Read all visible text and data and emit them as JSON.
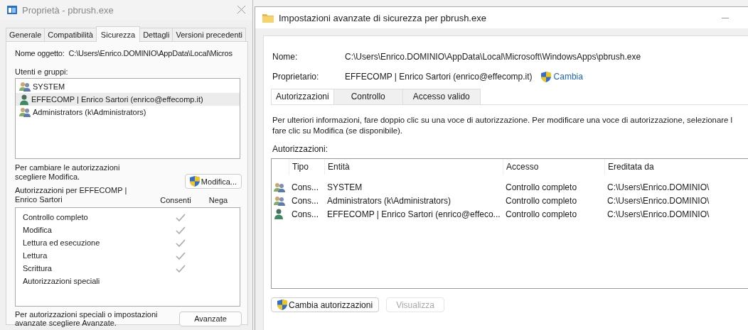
{
  "properties_window": {
    "title": "Proprietà - pbrush.exe",
    "tabs": [
      {
        "label": "Generale",
        "selected": false
      },
      {
        "label": "Compatibilità",
        "selected": false
      },
      {
        "label": "Sicurezza",
        "selected": true
      },
      {
        "label": "Dettagli",
        "selected": false
      },
      {
        "label": "Versioni precedenti",
        "selected": false
      }
    ],
    "object_name_label": "Nome oggetto:",
    "object_name": "C:\\Users\\Enrico.DOMINIO\\AppData\\Local\\Micros",
    "groups_label": "Utenti e gruppi:",
    "groups": [
      {
        "name": "SYSTEM",
        "kind": "group",
        "selected": false
      },
      {
        "name": "EFFECOMP | Enrico Sartori (enrico@effecomp.it)",
        "kind": "user",
        "selected": true
      },
      {
        "name": "Administrators (k\\Administrators)",
        "kind": "group",
        "selected": false
      }
    ],
    "change_hint": "Per cambiare le autorizzazioni scegliere Modifica.",
    "edit_button": "Modifica...",
    "permissions_label": "Autorizzazioni per EFFECOMP | Enrico Sartori",
    "allow_header": "Consenti",
    "deny_header": "Nega",
    "permissions": [
      {
        "name": "Controllo completo",
        "allow": true,
        "deny": false
      },
      {
        "name": "Modifica",
        "allow": true,
        "deny": false
      },
      {
        "name": "Lettura ed esecuzione",
        "allow": true,
        "deny": false
      },
      {
        "name": "Lettura",
        "allow": true,
        "deny": false
      },
      {
        "name": "Scrittura",
        "allow": true,
        "deny": false
      },
      {
        "name": "Autorizzazioni speciali",
        "allow": false,
        "deny": false
      }
    ],
    "advanced_hint": "Per autorizzazioni speciali o impostazioni avanzate scegliere Avanzate.",
    "advanced_button": "Avanzate"
  },
  "advanced_window": {
    "title": "Impostazioni avanzate di sicurezza per pbrush.exe",
    "name_label": "Nome:",
    "name": "C:\\Users\\Enrico.DOMINIO\\AppData\\Local\\Microsoft\\WindowsApps\\pbrush.exe",
    "owner_label": "Proprietario:",
    "owner": "EFFECOMP | Enrico Sartori (enrico@effecomp.it)",
    "change_link": "Cambia",
    "tabs": [
      {
        "label": "Autorizzazioni",
        "selected": true
      },
      {
        "label": "Controllo",
        "selected": false
      },
      {
        "label": "Accesso valido",
        "selected": false
      }
    ],
    "info_lines": [
      "Per ulteriori informazioni, fare doppio clic su una voce di autorizzazione. Per modificare una voce di autorizzazione, selezionare l",
      "fare clic su Modifica (se disponibile)."
    ],
    "permissions_label": "Autorizzazioni:",
    "table": {
      "columns": [
        "Tipo",
        "Entità",
        "Accesso",
        "Ereditata da"
      ],
      "rows": [
        {
          "kind": "group",
          "type": "Cons...",
          "entity": "SYSTEM",
          "access": "Controllo completo",
          "inherited_from": "C:\\Users\\Enrico.DOMINIO\\"
        },
        {
          "kind": "group",
          "type": "Cons...",
          "entity": "Administrators (k\\Administrators)",
          "access": "Controllo completo",
          "inherited_from": "C:\\Users\\Enrico.DOMINIO\\"
        },
        {
          "kind": "user",
          "type": "Cons...",
          "entity": "EFFECOMP | Enrico Sartori (enrico@effeco...",
          "access": "Controllo completo",
          "inherited_from": "C:\\Users\\Enrico.DOMINIO\\"
        }
      ]
    },
    "buttons": [
      {
        "label": "Cambia autorizzazioni",
        "shield": true,
        "disabled": false
      },
      {
        "label": "Visualizza",
        "shield": false,
        "disabled": true
      }
    ]
  }
}
